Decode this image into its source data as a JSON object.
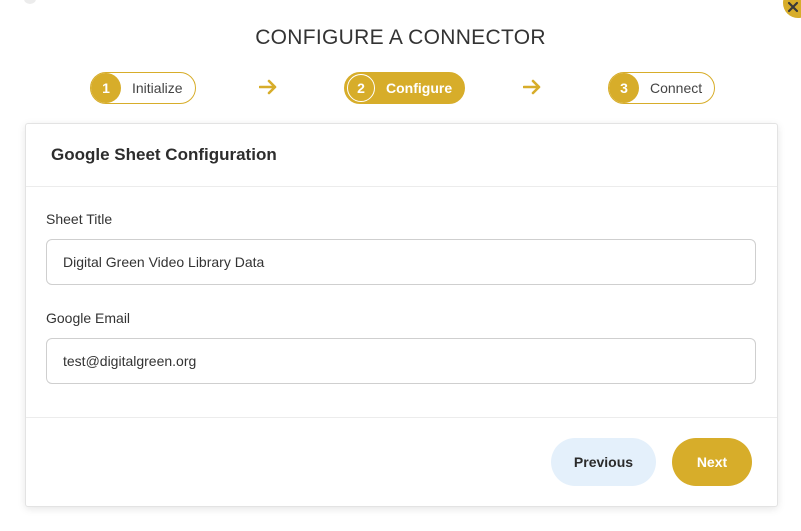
{
  "dialog": {
    "title": "CONFIGURE A CONNECTOR"
  },
  "stepper": {
    "steps": [
      {
        "number": "1",
        "label": "Initialize",
        "state": "done"
      },
      {
        "number": "2",
        "label": "Configure",
        "state": "active"
      },
      {
        "number": "3",
        "label": "Connect",
        "state": "pending"
      }
    ]
  },
  "card": {
    "header": "Google Sheet Configuration",
    "fields": [
      {
        "label": "Sheet Title",
        "value": "Digital Green Video Library Data"
      },
      {
        "label": "Google Email",
        "value": "test@digitalgreen.org"
      }
    ],
    "buttons": {
      "previous": "Previous",
      "next": "Next"
    }
  },
  "colors": {
    "accent": "#d7ad2a",
    "secondary_button_bg": "#e4f0fb"
  },
  "icons": {
    "close": "close-icon",
    "step_arrow": "arrow-right-icon"
  }
}
